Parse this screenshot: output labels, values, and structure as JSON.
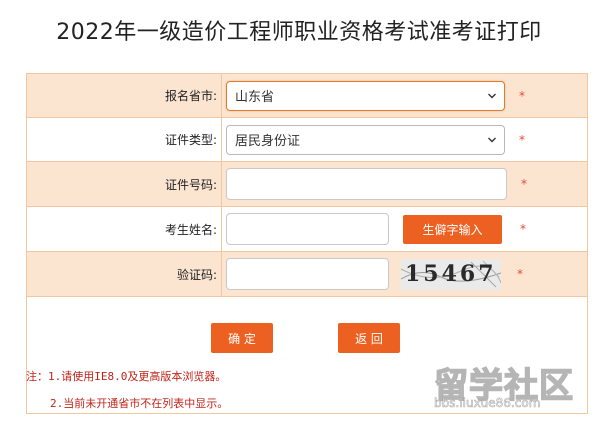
{
  "page": {
    "title": "2022年一级造价工程师职业资格考试准考证打印"
  },
  "form": {
    "province": {
      "label": "报名省市:",
      "value": "山东省"
    },
    "id_type": {
      "label": "证件类型:",
      "value": "居民身份证"
    },
    "id_number": {
      "label": "证件号码:",
      "value": "",
      "placeholder": ""
    },
    "name": {
      "label": "考生姓名:",
      "value": "",
      "rare_char_button": "生僻字输入"
    },
    "captcha": {
      "label": "验证码:",
      "value": "",
      "image_text": "15467"
    },
    "required_mark": "*"
  },
  "buttons": {
    "confirm": "确 定",
    "back": "返 回"
  },
  "notes": {
    "line1": "注：1.请使用IE8.0及更高版本浏览器。",
    "line2": "2.当前未开通省市不在列表中显示。"
  },
  "watermark": {
    "text": "留学社区",
    "url": "bbs.liuxue86.com"
  },
  "colors": {
    "accent": "#ec6121",
    "row_tint": "#fbe5d1",
    "border": "#f1c7a2",
    "note_red": "#c0241a"
  }
}
